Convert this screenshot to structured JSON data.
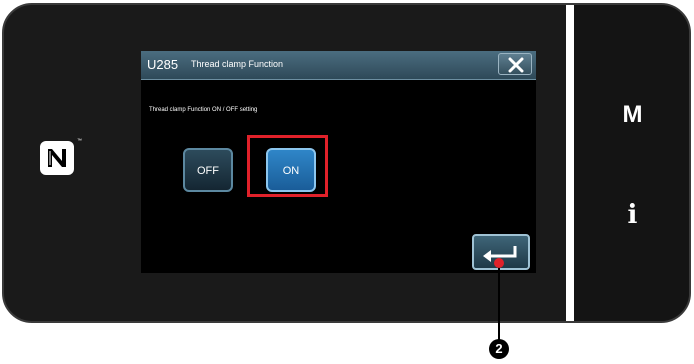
{
  "dialog": {
    "code": "U285",
    "title": "Thread clamp Function",
    "setting_label": "Thread clamp Function ON / OFF setting"
  },
  "options": {
    "off_label": "OFF",
    "on_label": "ON",
    "selected": "ON"
  },
  "side_panel": {
    "mode_label": "M",
    "info_label": "i"
  },
  "nfc": {
    "trademark": "™"
  },
  "annotation": {
    "callout_number": "2"
  },
  "colors": {
    "selected_button": "#2f86c8",
    "highlight": "#e0212a",
    "titlebar": "#3d5d6f"
  }
}
